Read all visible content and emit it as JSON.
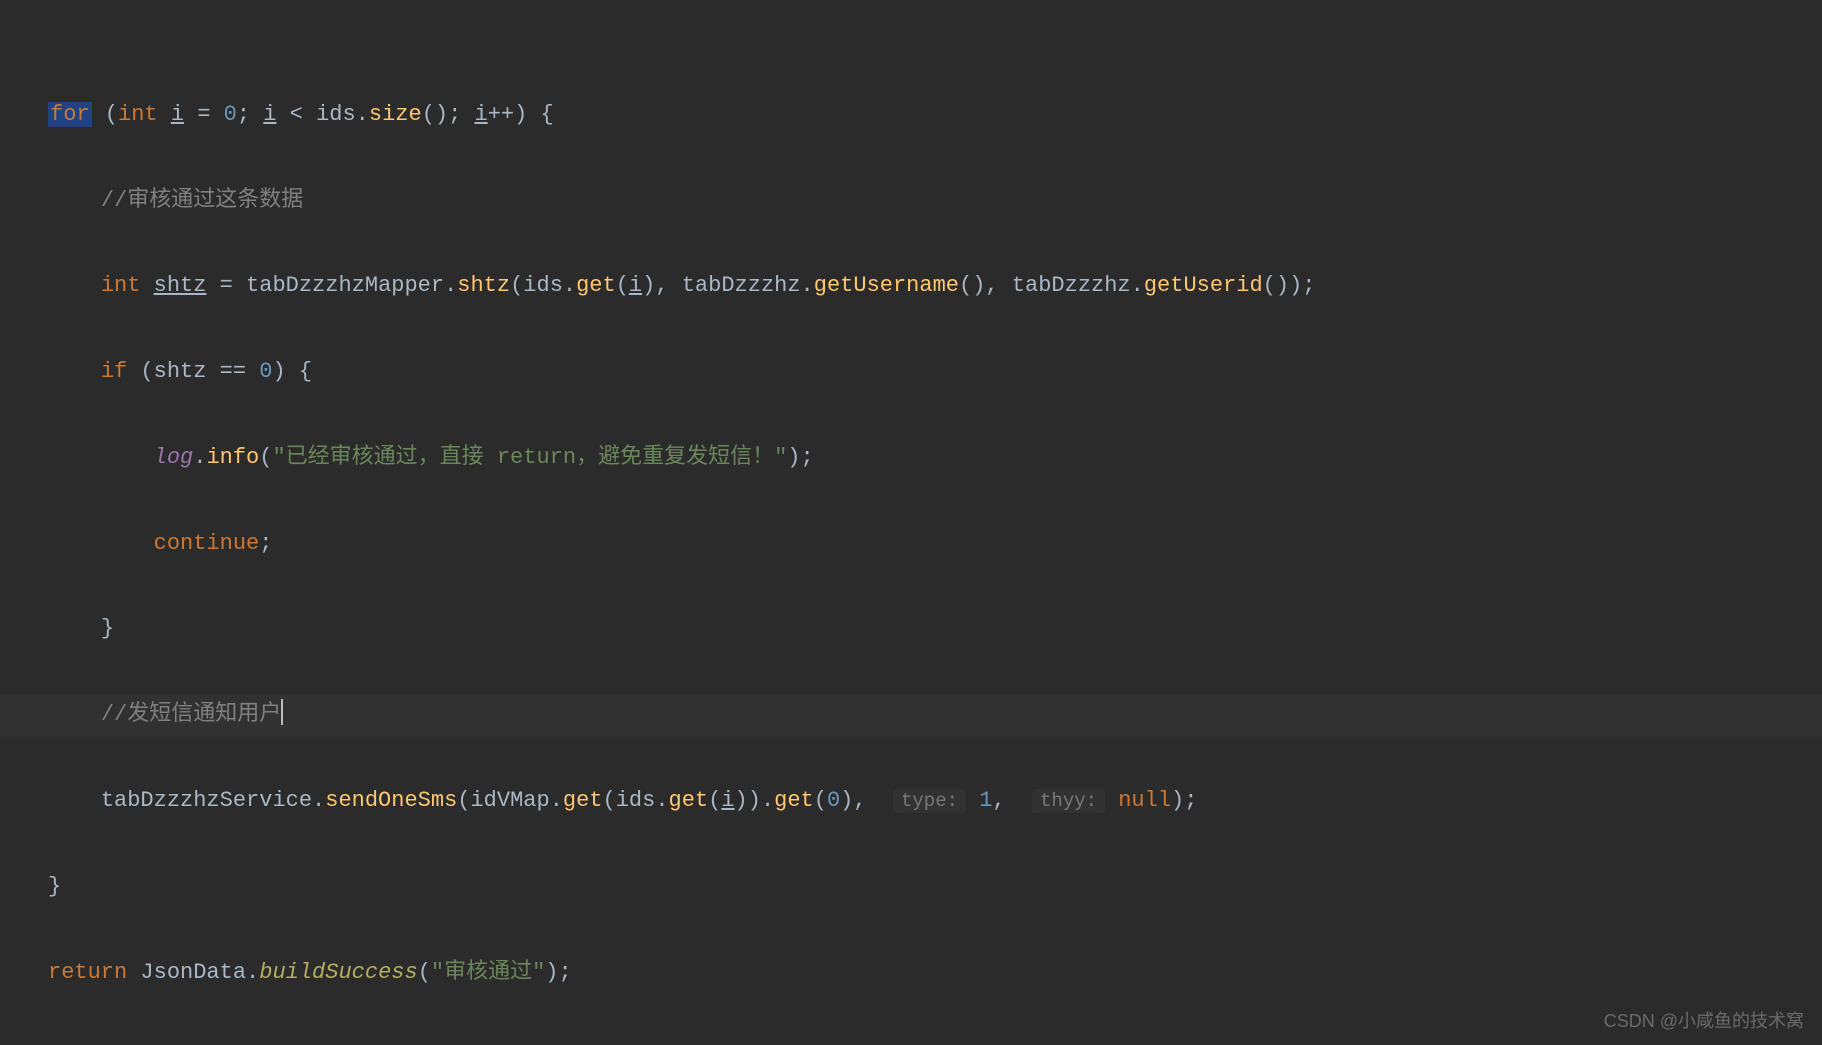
{
  "code": {
    "line1": {
      "for": "for",
      "int": "int",
      "i": "i",
      "eq": " = ",
      "zero": "0",
      "semi1": "; ",
      "i2": "i",
      "lt": " < ids.",
      "size": "size",
      "paren": "(); ",
      "i3": "i",
      "pp": "++) {"
    },
    "line2": {
      "comment": "//审核通过这条数据"
    },
    "line3": {
      "int": "int",
      "sp1": " ",
      "shtz": "shtz",
      "eq": " = tabDzzzhzMapper.",
      "method": "shtz",
      "p1": "(ids.",
      "get": "get",
      "p2": "(",
      "i": "i",
      "p3": "), tabDzzzhz.",
      "getUsername": "getUsername",
      "p4": "(), tabDzzzhz.",
      "getUserid": "getUserid",
      "p5": "());"
    },
    "line4": {
      "if": "if",
      "p1": " (shtz == ",
      "zero": "0",
      "p2": ") {"
    },
    "line5": {
      "log": "log",
      "dot": ".",
      "info": "info",
      "p1": "(",
      "str": "\"已经审核通过，直接 return，避免重复发短信！\"",
      "p2": ");"
    },
    "line6": {
      "continue": "continue",
      "semi": ";"
    },
    "line7": {
      "brace": "}"
    },
    "line8": {
      "comment": "//发短信通知用户"
    },
    "line9": {
      "svc": "tabDzzzhzService.",
      "method": "sendOneSms",
      "p1": "(idVMap.",
      "get1": "get",
      "p2": "(ids.",
      "get2": "get",
      "p3": "(",
      "i": "i",
      "p4": ")).",
      "get3": "get",
      "p5": "(",
      "zero": "0",
      "p6": "), ",
      "hint1": "type:",
      "sp1": " ",
      "one": "1",
      "comma": ", ",
      "hint2": "thyy:",
      "sp2": " ",
      "null": "null",
      "p7": ");"
    },
    "line10": {
      "brace": "}"
    },
    "line11": {
      "return": "return",
      "sp": " JsonData.",
      "method": "buildSuccess",
      "p1": "(",
      "str": "\"审核通过\"",
      "p2": ");"
    }
  },
  "watermark": "CSDN @小咸鱼的技术窝"
}
